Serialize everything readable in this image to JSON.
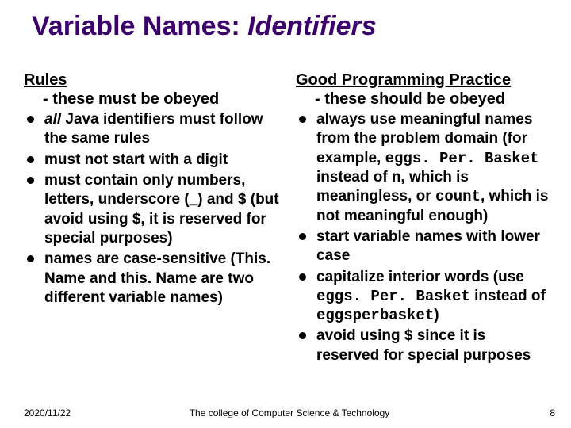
{
  "title": {
    "plain": "Variable Names: ",
    "italic": "Identifiers"
  },
  "left": {
    "heading": "Rules",
    "subhead": "- these must be obeyed",
    "items": {
      "i0": {
        "prefix_ital": "all",
        "rest": " Java identifiers must follow the same rules"
      },
      "i1": {
        "text": "must not start with a digit"
      },
      "i2": {
        "text": "must contain only numbers, letters, underscore (_) and $ (but avoid using $, it is reserved for special purposes)"
      },
      "i3": {
        "text": "names are case-sensitive (This. Name and this. Name are two different variable names)"
      }
    }
  },
  "right": {
    "heading": "Good Programming Practice",
    "subhead": "- these should be obeyed",
    "items": {
      "i0": {
        "a": "always use meaningful names from the problem domain (for example, ",
        "code1": "eggs. Per. Basket",
        "b": " instead of ",
        "code2": "n",
        "c": ", which is meaningless, or ",
        "code3": "count",
        "d": ", which is not meaningful enough)"
      },
      "i1": {
        "text": "start variable names with lower case"
      },
      "i2": {
        "a": "capitalize interior words (use ",
        "code1": "eggs. Per. Basket",
        "b": " instead of ",
        "code2": "eggsperbasket",
        "c": ")"
      },
      "i3": {
        "text": "avoid using $ since it is reserved for special purposes"
      }
    }
  },
  "footer": {
    "date": "2020/11/22",
    "center": "The college of Computer Science & Technology",
    "page": "8"
  }
}
